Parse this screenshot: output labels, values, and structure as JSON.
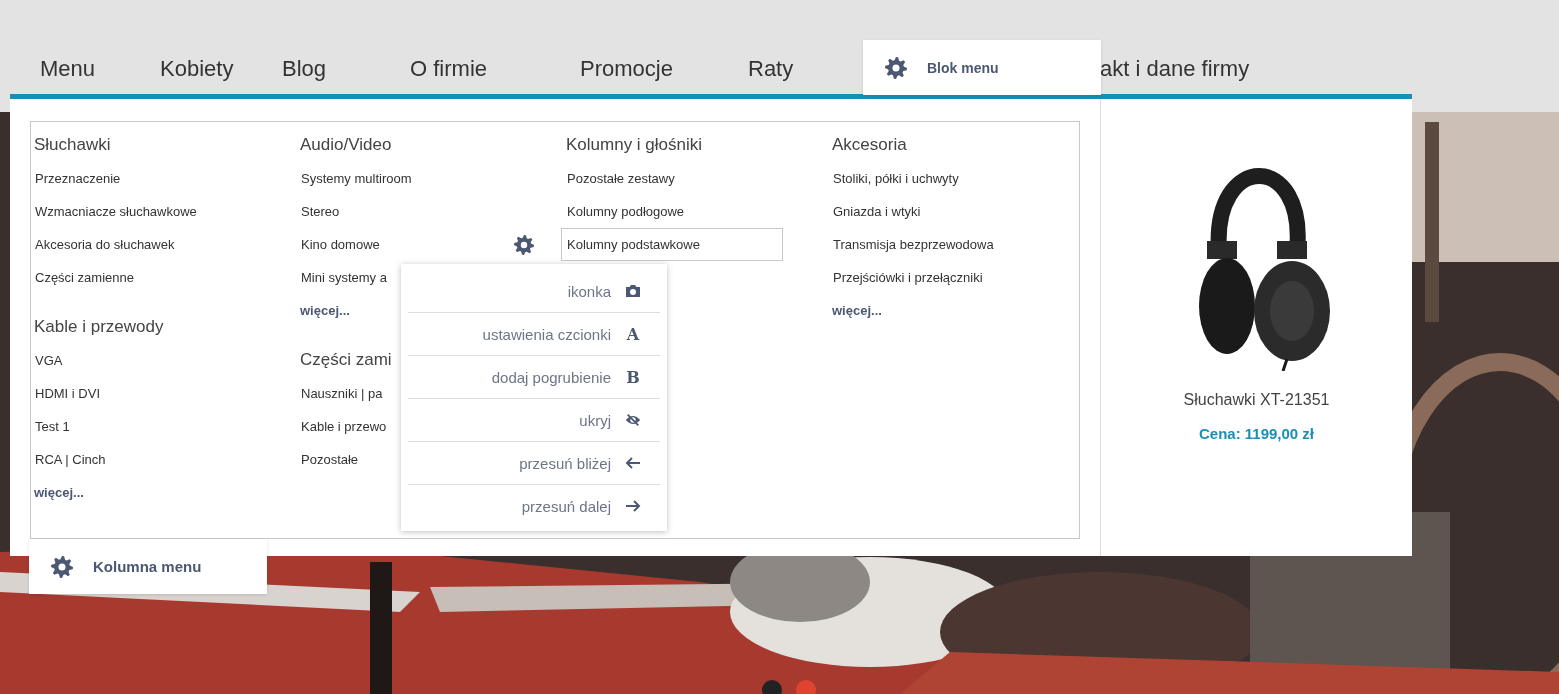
{
  "nav": [
    {
      "label": "Menu"
    },
    {
      "label": "Kobiety"
    },
    {
      "label": "Blog"
    },
    {
      "label": "O firmie"
    },
    {
      "label": "Promocje"
    },
    {
      "label": "Raty"
    },
    {
      "label": "akt i dane firmy"
    }
  ],
  "block_tooltip": {
    "label": "Blok menu"
  },
  "columns": [
    {
      "groups": [
        {
          "title": "Słuchawki",
          "items": [
            {
              "label": "Przeznaczenie",
              "selected": false
            },
            {
              "label": "Wzmacniacze słuchawkowe",
              "selected": false
            },
            {
              "label": "Akcesoria do słuchawek",
              "selected": false
            },
            {
              "label": "Części zamienne",
              "selected": false
            }
          ]
        },
        {
          "title": "Kable i przewody",
          "items": [
            {
              "label": "VGA",
              "selected": false
            },
            {
              "label": "HDMI i DVI",
              "selected": false
            },
            {
              "label": "Test 1",
              "selected": false
            },
            {
              "label": "RCA | Cinch",
              "selected": false
            }
          ],
          "more": "więcej..."
        }
      ]
    },
    {
      "groups": [
        {
          "title": "Audio/Video",
          "items": [
            {
              "label": "Systemy multiroom",
              "selected": false
            },
            {
              "label": "Stereo",
              "selected": false
            },
            {
              "label": "Kino domowe",
              "selected": false
            },
            {
              "label": "Mini systemy a",
              "selected": false
            }
          ],
          "more": "więcej..."
        },
        {
          "title": "Części zami",
          "items": [
            {
              "label": "Nauszniki | pa",
              "selected": false
            },
            {
              "label": "Kable i przewo",
              "selected": false
            },
            {
              "label": "Pozostałe",
              "selected": false
            }
          ]
        }
      ]
    },
    {
      "groups": [
        {
          "title": "Kolumny i głośniki",
          "items": [
            {
              "label": "Pozostałe zestawy",
              "selected": false
            },
            {
              "label": "Kolumny podłogowe",
              "selected": false
            },
            {
              "label": "Kolumny podstawkowe",
              "selected": true
            }
          ]
        }
      ]
    },
    {
      "groups": [
        {
          "title": "Akcesoria",
          "items": [
            {
              "label": "Stoliki, półki i uchwyty",
              "selected": false
            },
            {
              "label": "Gniazda i wtyki",
              "selected": false
            },
            {
              "label": "Transmisja bezprzewodowa",
              "selected": false
            },
            {
              "label": "Przejściówki i przełączniki",
              "selected": false
            }
          ],
          "more": "więcej..."
        }
      ]
    }
  ],
  "context_menu": [
    {
      "label": "ikonka",
      "kind": "camera"
    },
    {
      "label": "ustawienia czcionki",
      "kind": "letter",
      "glyph": "A"
    },
    {
      "label": "dodaj pogrubienie",
      "kind": "letter",
      "glyph": "B"
    },
    {
      "label": "ukryj",
      "kind": "hide"
    },
    {
      "label": "przesuń bliżej",
      "kind": "back"
    },
    {
      "label": "przesuń dalej",
      "kind": "forward"
    }
  ],
  "column_tooltip": {
    "label": "Kolumna menu"
  },
  "product": {
    "name": "Słuchawki XT-21351",
    "price": "Cena: 1199,00 zł"
  },
  "slider_dots": [
    {
      "selected": false
    },
    {
      "selected": true
    }
  ]
}
